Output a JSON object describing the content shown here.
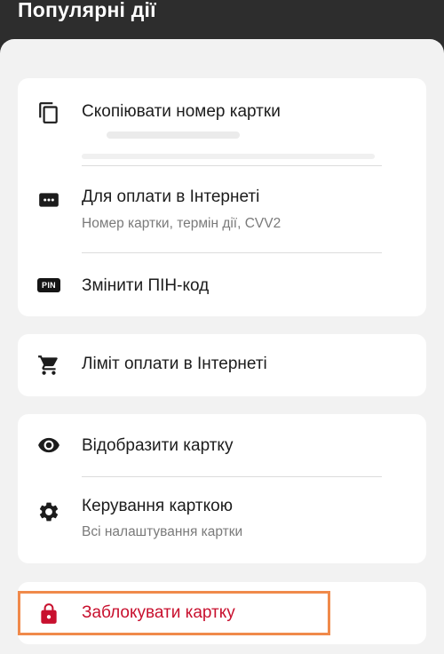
{
  "header": {
    "title": "Популярні дії"
  },
  "cards": [
    {
      "items": [
        {
          "icon": "copy-icon",
          "label": "Скопіювати номер картки"
        },
        {
          "icon": "dots-card-icon",
          "label": "Для оплати в Інтернеті",
          "sublabel": "Номер картки, термін дії, CVV2"
        },
        {
          "icon": "pin-icon",
          "icon_text": "PIN",
          "label": "Змінити ПІН-код"
        }
      ]
    },
    {
      "items": [
        {
          "icon": "cart-icon",
          "label": "Ліміт оплати в Інтернеті"
        }
      ]
    },
    {
      "items": [
        {
          "icon": "eye-icon",
          "label": "Відобразити картку"
        },
        {
          "icon": "gear-icon",
          "label": "Керування карткою",
          "sublabel": "Всі налаштування картки"
        }
      ]
    },
    {
      "items": [
        {
          "icon": "lock-icon",
          "label": "Заблокувати картку"
        }
      ]
    }
  ],
  "colors": {
    "header_bg": "#2d2d2d",
    "sheet_bg": "#f2f2f2",
    "danger": "#c8102e",
    "highlight": "#f08a4b"
  }
}
